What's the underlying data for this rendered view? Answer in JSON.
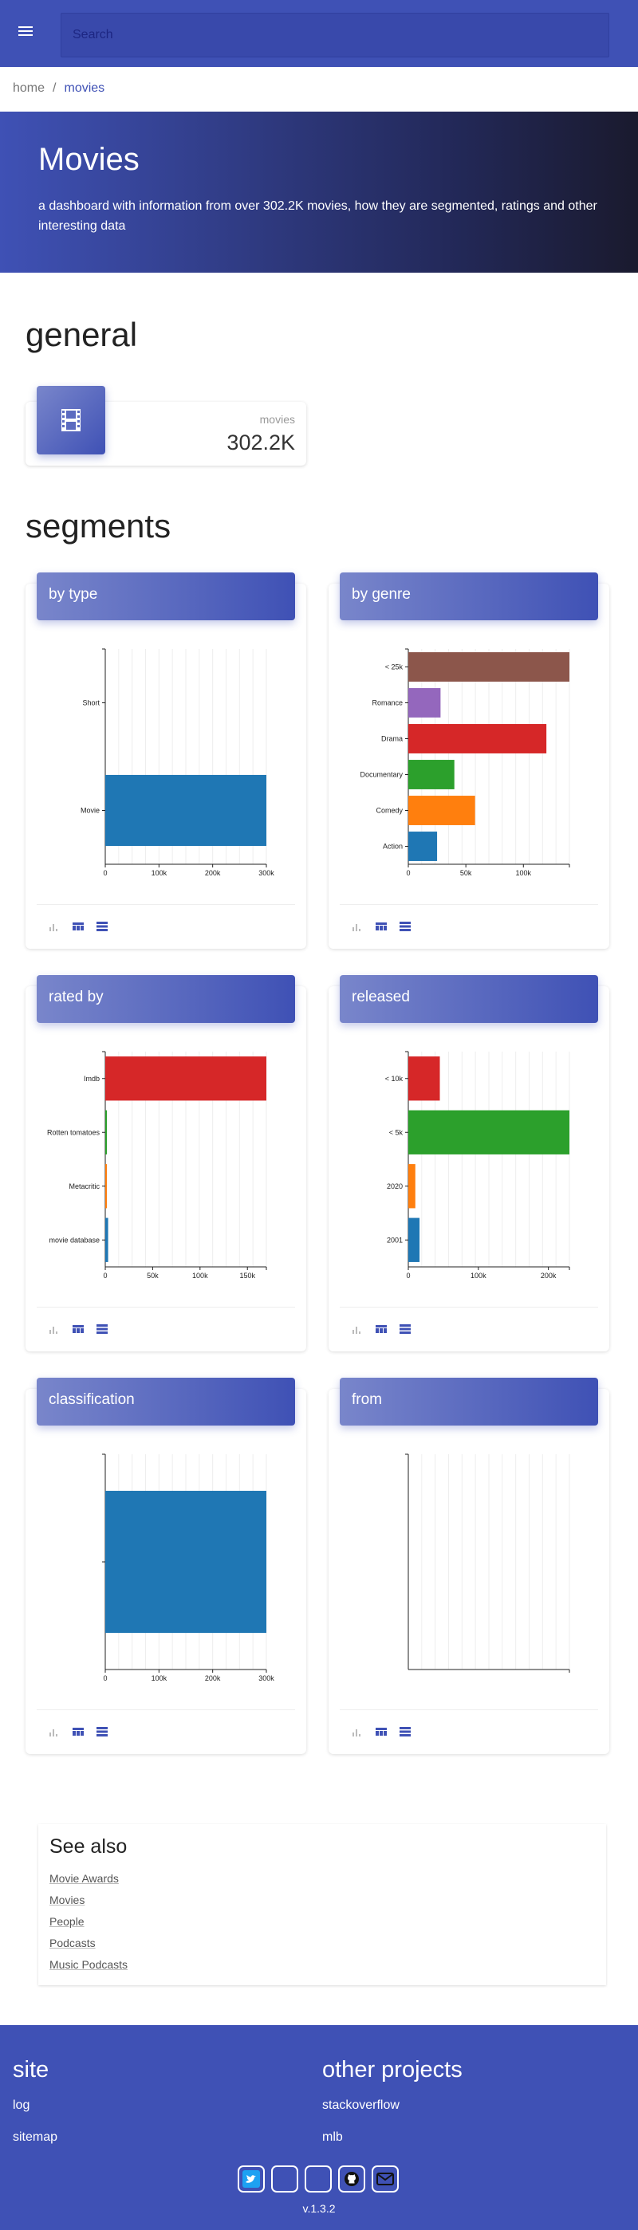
{
  "search": {
    "placeholder": "Search"
  },
  "breadcrumb": {
    "home": "home",
    "separator": "/",
    "current": "movies"
  },
  "hero": {
    "title": "Movies",
    "description": "a dashboard with information from over 302.2K movies, how they are segmented, ratings and other interesting data"
  },
  "general": {
    "title": "general",
    "stat": {
      "label": "movies",
      "value": "302.2K",
      "icon": "film-icon"
    }
  },
  "segments": {
    "title": "segments"
  },
  "colors": {
    "primary": "#3f51b5",
    "blue": "#1f77b4",
    "orange": "#ff7f0e",
    "green": "#2ca02c",
    "red": "#d62728",
    "purple": "#9467bd",
    "brown": "#8c564b"
  },
  "cards": [
    {
      "title": "by type"
    },
    {
      "title": "by genre"
    },
    {
      "title": "rated by"
    },
    {
      "title": "released"
    },
    {
      "title": "classification"
    },
    {
      "title": "from"
    }
  ],
  "chart_data": [
    {
      "type": "bar",
      "orientation": "horizontal",
      "categories": [
        "Short",
        "Movie"
      ],
      "values": [
        0,
        300000
      ],
      "colors": [
        "#1f77b4",
        "#1f77b4"
      ],
      "xlim": [
        0,
        300000
      ],
      "xticks": [
        "0",
        "100k",
        "200k",
        "300k"
      ]
    },
    {
      "type": "bar",
      "orientation": "horizontal",
      "categories": [
        "< 25k",
        "Romance",
        "Drama",
        "Documentary",
        "Comedy",
        "Action"
      ],
      "values": [
        140000,
        28000,
        120000,
        40000,
        58000,
        25000
      ],
      "colors": [
        "#8c564b",
        "#9467bd",
        "#d62728",
        "#2ca02c",
        "#ff7f0e",
        "#1f77b4"
      ],
      "xlim": [
        0,
        140000
      ],
      "xticks": [
        "0",
        "50k",
        "100k"
      ]
    },
    {
      "type": "bar",
      "orientation": "horizontal",
      "categories": [
        "Imdb",
        "Rotten tomatoes",
        "Metacritic",
        "movie database"
      ],
      "values": [
        170000,
        1200,
        400,
        3000
      ],
      "colors": [
        "#d62728",
        "#2ca02c",
        "#ff7f0e",
        "#1f77b4"
      ],
      "xlim": [
        0,
        170000
      ],
      "xticks": [
        "0",
        "50k",
        "100k",
        "150k"
      ]
    },
    {
      "type": "bar",
      "orientation": "horizontal",
      "categories": [
        "< 10k",
        "< 5k",
        "2020",
        "2001"
      ],
      "values": [
        45000,
        230000,
        10000,
        16000
      ],
      "colors": [
        "#d62728",
        "#2ca02c",
        "#ff7f0e",
        "#1f77b4"
      ],
      "xlim": [
        0,
        230000
      ],
      "xticks": [
        "0",
        "100k",
        "200k"
      ]
    },
    {
      "type": "bar",
      "orientation": "horizontal",
      "categories": [
        ""
      ],
      "values": [
        300000
      ],
      "colors": [
        "#1f77b4"
      ],
      "xlim": [
        0,
        300000
      ],
      "xticks": [
        "0",
        "100k",
        "200k",
        "300k"
      ]
    },
    {
      "type": "bar",
      "orientation": "horizontal",
      "categories": [],
      "values": [],
      "colors": [],
      "xlim": [
        0,
        1
      ],
      "xticks": []
    }
  ],
  "see_also": {
    "title": "See also",
    "links": [
      "Movie Awards",
      "Movies",
      "People",
      "Podcasts",
      "Music Podcasts"
    ]
  },
  "footer": {
    "site_title": "site",
    "site_links": [
      "log",
      "sitemap"
    ],
    "projects_title": "other projects",
    "project_links": [
      "stackoverflow",
      "mlb"
    ],
    "social_icons": [
      "twitter-icon",
      "blank-icon",
      "blank-icon",
      "github-icon",
      "mail-icon"
    ],
    "version": "v.1.3.2"
  }
}
